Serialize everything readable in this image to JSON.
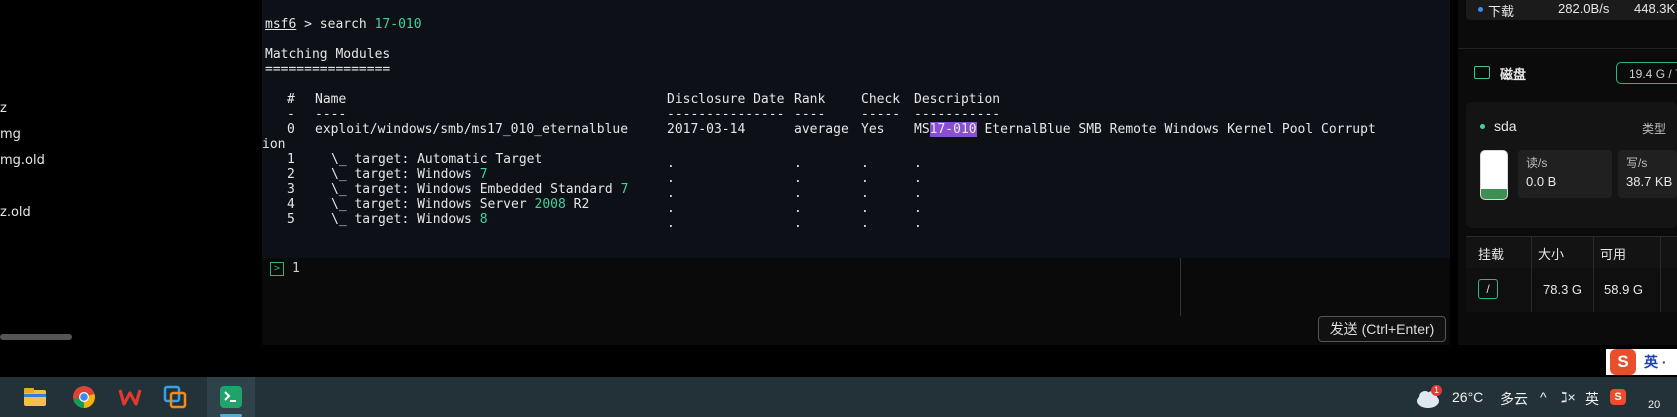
{
  "left_files": [
    "z",
    "mg",
    "mg.old",
    "z.old"
  ],
  "terminal": {
    "prompt": "msf6",
    "prompt_sep": " > ",
    "command": "search ",
    "command_arg": "17-010",
    "heading": "Matching Modules",
    "heading_rule": "================",
    "col_num": "#",
    "col_name": "Name",
    "col_date": "Disclosure Date",
    "col_rank": "Rank",
    "col_check": "Check",
    "col_desc": "Description",
    "rule_num": "-",
    "rule_name": "----",
    "rule_date": "---------------",
    "rule_rank": "----",
    "rule_check": "-----",
    "rule_desc": "-----------",
    "row0": {
      "num": "0",
      "name": "exploit/windows/smb/ms17_010_eternalblue",
      "date": "2017-03-14",
      "rank": "average",
      "check": "Yes",
      "desc_pre": "MS",
      "desc_hl": "17-010",
      "desc_post": " EternalBlue SMB Remote Windows Kernel Pool Corrupt",
      "desc_wrap": "ion"
    },
    "targets": [
      {
        "num": "1",
        "text": "\\_ target: Automatic Target",
        "hl": ""
      },
      {
        "num": "2",
        "text": "\\_ target: Windows ",
        "hl": "7"
      },
      {
        "num": "3",
        "text": "\\_ target: Windows Embedded Standard ",
        "hl": "7"
      },
      {
        "num": "4",
        "text": "\\_ target: Windows Server ",
        "hl": "2008",
        "post": " R2"
      },
      {
        "num": "5",
        "text": "\\_ target: Windows ",
        "hl": "8"
      }
    ],
    "dot": "."
  },
  "input": {
    "line_number": "1",
    "chevron": ">"
  },
  "send_button": "发送 (Ctrl+Enter)",
  "right_panel": {
    "net_label": "下载",
    "net_speed": "282.0B/s",
    "net_total": "448.3K",
    "disk_title": "磁盘",
    "disk_usage": "19.4 G / 7",
    "drive_name": "sda",
    "drive_type": "类型",
    "drive_fill_fraction": 0.2,
    "read_label": "读/s",
    "read_value": "0.0 B",
    "write_label": "写/s",
    "write_value": "38.7 KB",
    "col_mount": "挂载",
    "col_size": "大小",
    "col_avail": "可用",
    "mount": "/",
    "size": "78.3 G",
    "avail": "58.9 G"
  },
  "ime": {
    "logo": "S",
    "text": "英 ·"
  },
  "taskbar": {
    "weather_badge": "1",
    "temperature": "26°C",
    "weather": "多云",
    "tray_chevron": "^",
    "volume": "ℷ×",
    "lang": "英",
    "time_partial": "20"
  },
  "colors": {
    "accent_green": "#3fd29a",
    "highlight": "#8a4fd1",
    "taskbar": "#233238"
  }
}
